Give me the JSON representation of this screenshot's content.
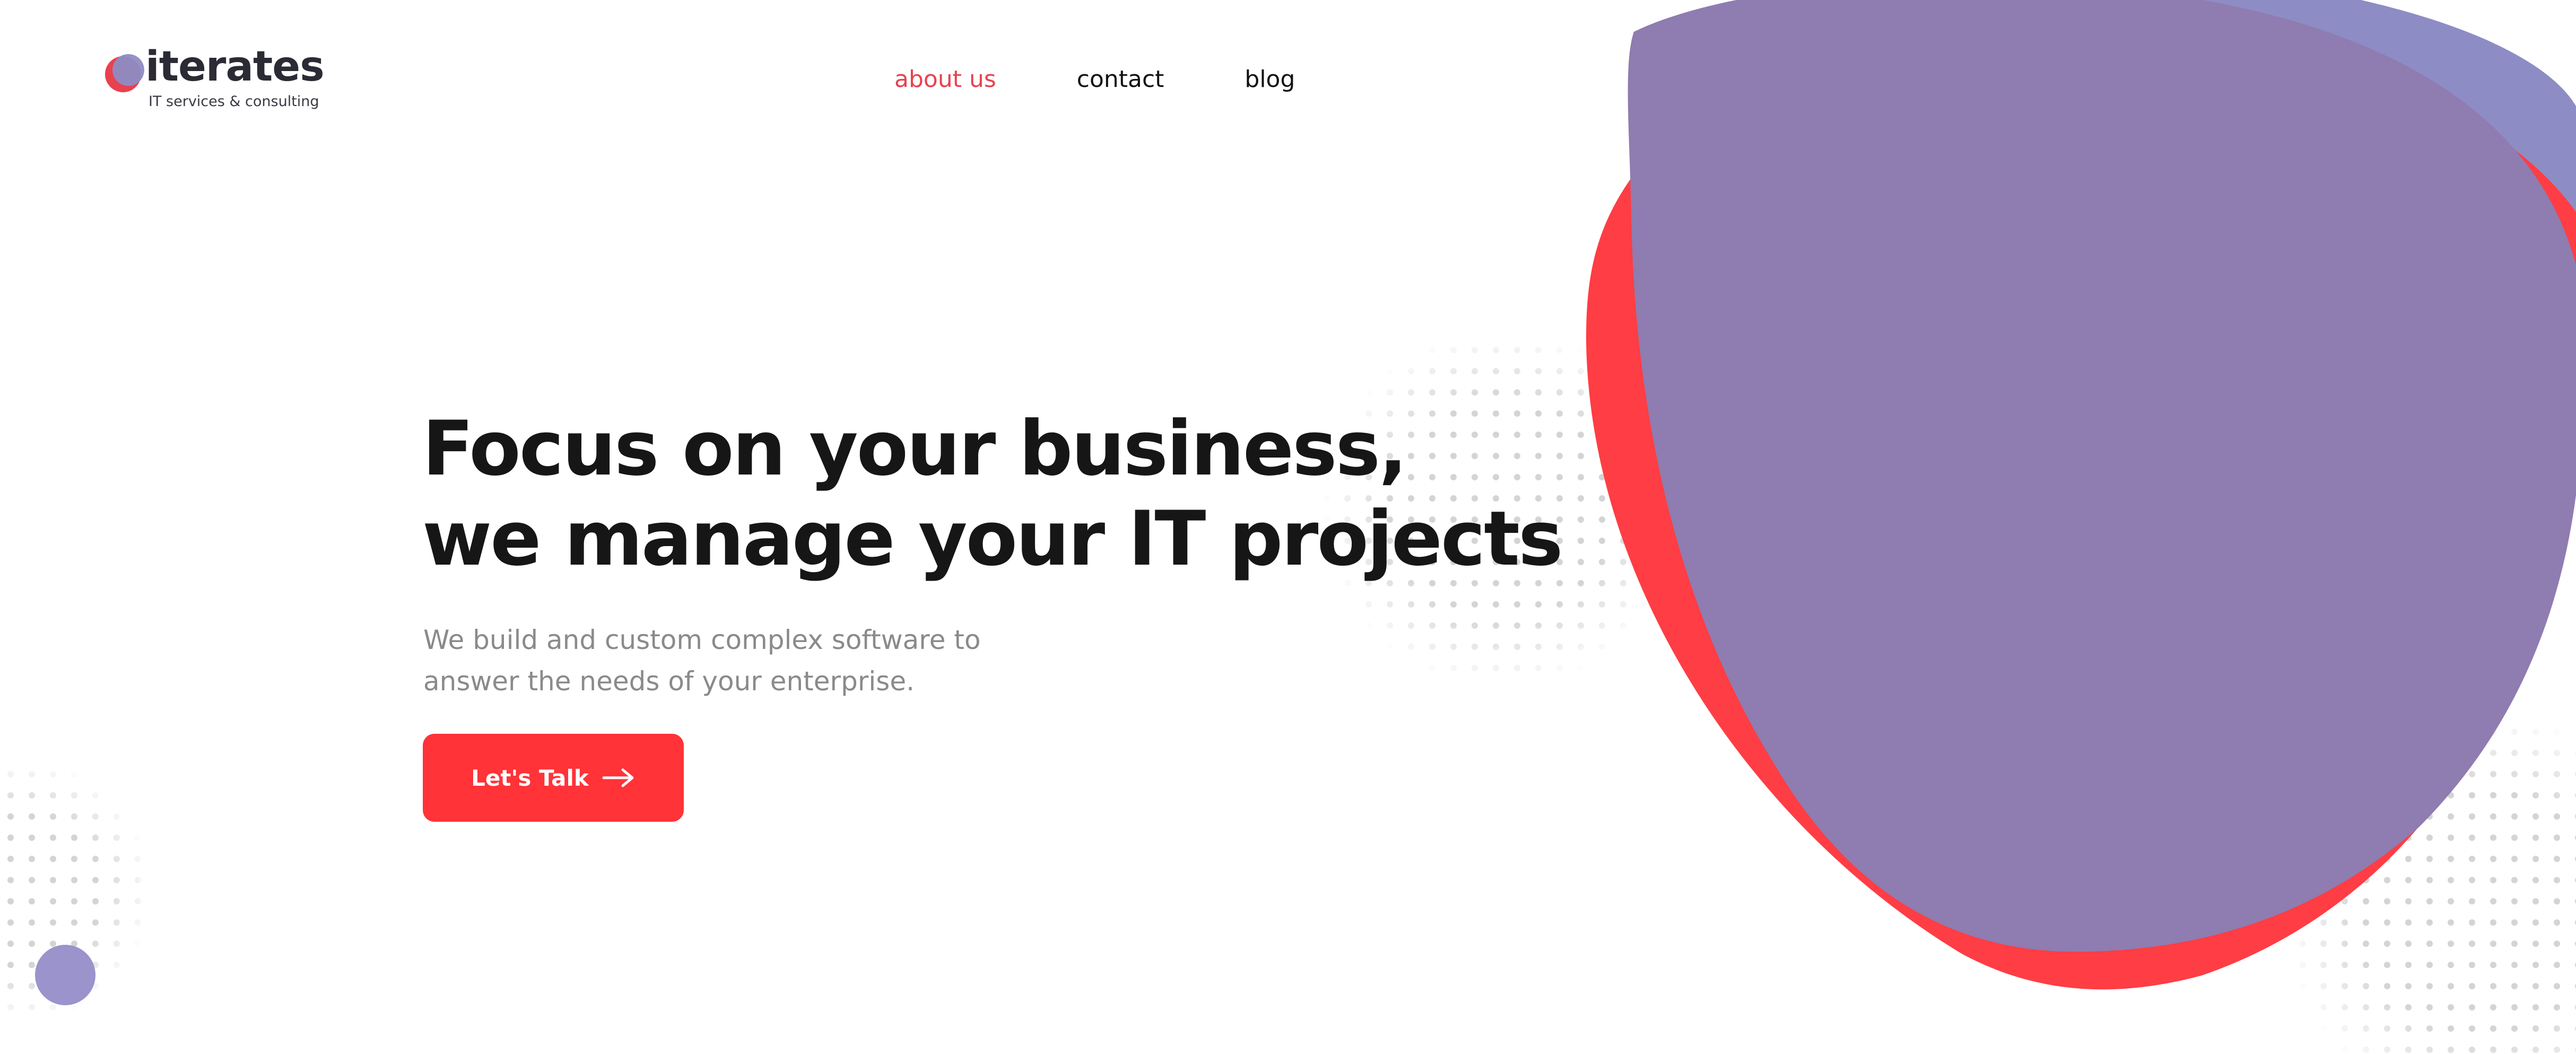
{
  "brand": {
    "name": "iterates",
    "tagline": "IT services & consulting"
  },
  "nav": {
    "items": [
      {
        "label": "about us",
        "active": true
      },
      {
        "label": "contact",
        "active": false
      },
      {
        "label": "blog",
        "active": false
      }
    ]
  },
  "hero": {
    "title_line1": "Focus on your business,",
    "title_line2": "we manage your IT projects",
    "subtitle_line1": "We build and custom complex software to",
    "subtitle_line2": "answer the needs of your enterprise.",
    "cta_label": "Let's Talk",
    "cta_icon": "arrow-right-icon"
  },
  "colors": {
    "accent_red": "#ff3d44",
    "accent_purple": "#8f7cb0",
    "accent_lavender": "#8e8cc4",
    "active_nav": "#e8424f",
    "heading": "#161616",
    "muted_text": "#8a8a8a",
    "dots": "#d4d4d4"
  }
}
